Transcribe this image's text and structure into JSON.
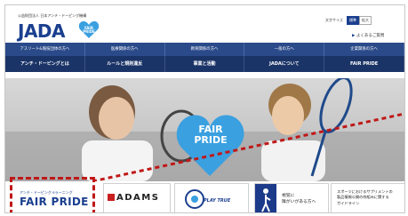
{
  "header": {
    "org_name": "公益財団法人 日本アンチ・ドーピング機構",
    "logo_text": "JADA",
    "font_size_label": "文字サイズ",
    "font_size_options": [
      "標準",
      "拡大"
    ],
    "faq_link": "よくあるご質問"
  },
  "audience_bar": [
    "アスリート&競技団体の方へ",
    "医療関係の方へ",
    "教育関係の方へ",
    "一般の方へ",
    "企業関係の方へ"
  ],
  "main_nav": [
    "アンチ・ドーピングとは",
    "ルールと規則違反",
    "事業と活動",
    "JADAについて",
    "FAIR PRIDE"
  ],
  "hero": {
    "logo_line1": "FAIR",
    "logo_line2": "PRIDE"
  },
  "banners": {
    "fair_pride_small": "アンチ・ドーピング eラーニング",
    "fair_pride_big": "FAIR PRIDE",
    "adams": "ADAMS",
    "play_true": "PLAY TRUE",
    "visual_impaired": "視覚に\n障がいがある方へ",
    "supplement": "スポーツにおけるサプリメントの\n製品情報公開の枠組みに関する\nガイドライン"
  },
  "colors": {
    "brand_navy": "#1b3467",
    "brand_blue": "#2a4a8a",
    "highlight_red": "#c01818",
    "heart_blue": "#3aa0e0"
  }
}
